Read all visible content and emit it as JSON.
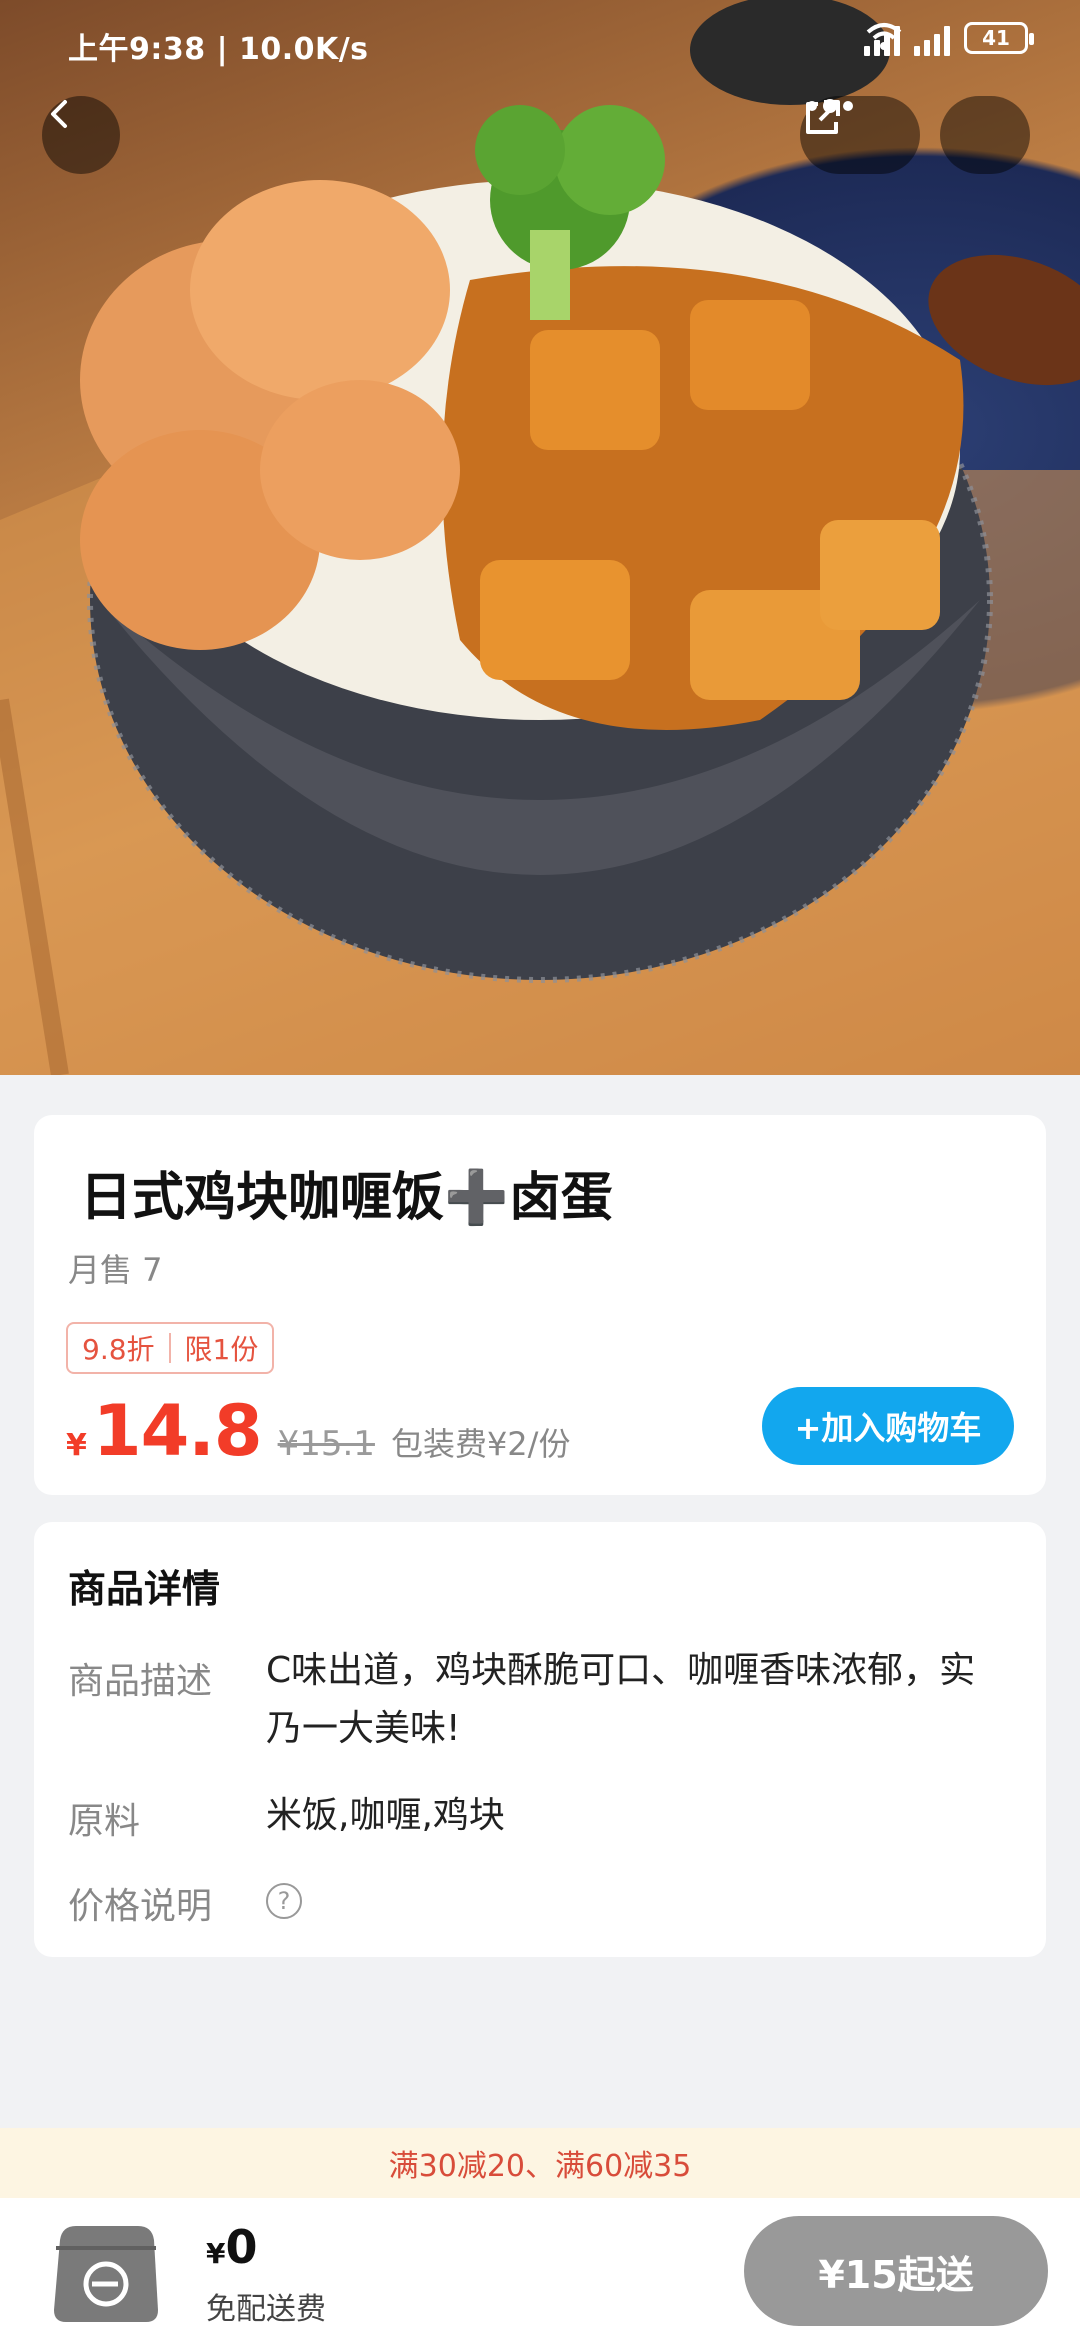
{
  "status_bar": {
    "time": "上午9:38 | 10.0K/s",
    "battery": "41"
  },
  "nav": {
    "back_icon": "chevron-left-icon",
    "more_icon": "more-dots-icon",
    "share_icon": "share-icon"
  },
  "product": {
    "title": "日式鸡块咖喱饭➕卤蛋",
    "monthly_sales": "月售 7",
    "discount_tag": "9.8折",
    "limit_tag": "限1份",
    "currency": "¥",
    "price": "14.8",
    "original_price": "¥15.1",
    "packing_fee": "包装费¥2/份",
    "add_to_cart_label": "+加入购物车"
  },
  "details": {
    "title": "商品详情",
    "description_label": "商品描述",
    "description_value": "C味出道，鸡块酥脆可口、咖喱香味浓郁，实乃一大美味!",
    "ingredients_label": "原料",
    "ingredients_value": "米饭,咖喱,鸡块",
    "price_note_label": "价格说明",
    "help_icon": "question-circle-icon"
  },
  "promo": {
    "text": "满30减20、满60减35"
  },
  "bottom": {
    "currency": "¥",
    "total": "0",
    "delivery_note": "免配送费",
    "min_order_label": "¥15起送"
  },
  "colors": {
    "price_red": "#f23c28",
    "cart_blue": "#12a7ee",
    "promo_bg": "#fdf5e2",
    "disabled_gray": "#999999"
  }
}
